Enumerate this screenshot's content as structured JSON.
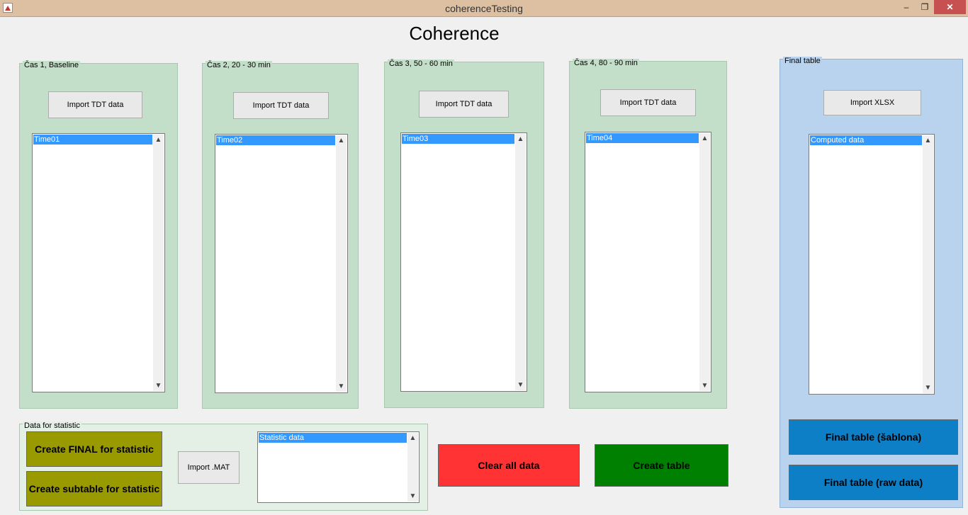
{
  "window": {
    "title": "coherenceTesting",
    "minimize": "–",
    "maximize": "❐",
    "close": "✕"
  },
  "heading": "Coherence",
  "panels": [
    {
      "legend": "Čas 1, Baseline",
      "button": "Import TDT data",
      "list_item": "Time01"
    },
    {
      "legend": "Čas 2, 20 - 30 min",
      "button": "Import TDT data",
      "list_item": "Time02"
    },
    {
      "legend": "Čas 3, 50 - 60 min",
      "button": "Import TDT data",
      "list_item": "Time03"
    },
    {
      "legend": "Čas 4, 80 - 90 min",
      "button": "Import TDT data",
      "list_item": "Time04"
    }
  ],
  "final_table": {
    "legend": "Final table",
    "import_button": "Import XLSX",
    "list_item": "Computed data",
    "sablona_button": "Final table (šablona)",
    "raw_button": "Final table (raw data)"
  },
  "statistic": {
    "legend": "Data for statistic",
    "create_final_button": "Create FINAL for statistic",
    "create_subtable_button": "Create subtable for statistic",
    "import_mat_button": "Import .MAT",
    "list_item": "Statistic data"
  },
  "actions": {
    "clear_button": "Clear all data",
    "create_table_button": "Create table"
  },
  "colors": {
    "clear": "#ff3333",
    "create_table": "#008000",
    "statistic_buttons": "#999900",
    "final_buttons": "#0c7fc7"
  },
  "icons": {
    "scroll_up": "▲",
    "scroll_down": "▼"
  }
}
